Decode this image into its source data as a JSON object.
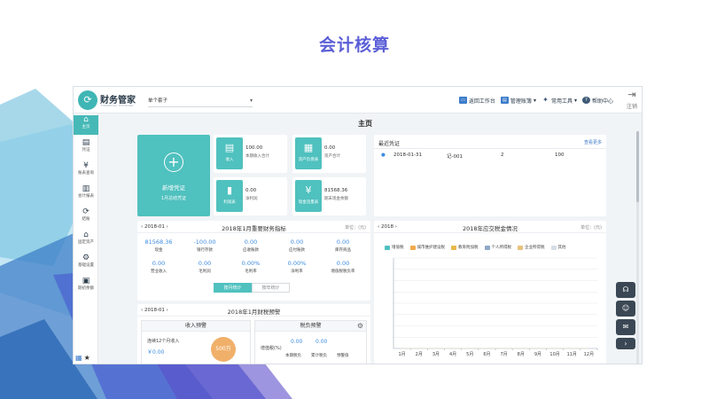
{
  "slide": {
    "title": "会计核算"
  },
  "brand": {
    "name": "财务管家",
    "tagline": "FINANCIAL STEWARD"
  },
  "account": {
    "selected": "单个套子"
  },
  "top_actions": [
    {
      "label": "返回工作台",
      "icon": "monitor-icon"
    },
    {
      "label": "管理账簿",
      "icon": "ledger-icon"
    },
    {
      "label": "常用工具",
      "icon": "wrench-icon"
    },
    {
      "label": "帮助中心",
      "icon": "help-icon"
    }
  ],
  "logout": {
    "label": "注销"
  },
  "sidenav": [
    {
      "label": "主页",
      "glyph": "⌂",
      "active": true
    },
    {
      "label": "凭证",
      "glyph": "▤"
    },
    {
      "label": "账表查询",
      "glyph": "¥"
    },
    {
      "label": "会计报表",
      "glyph": "▥"
    },
    {
      "label": "结账",
      "glyph": "⟳"
    },
    {
      "label": "固定资产",
      "glyph": "⌂"
    },
    {
      "label": "基础设置",
      "glyph": "⚙"
    },
    {
      "label": "期初余额",
      "glyph": "▣"
    }
  ],
  "main": {
    "title": "主页"
  },
  "new_voucher": {
    "label": "新增凭证",
    "sub": "1月总结凭证"
  },
  "tiles": [
    {
      "name": "income",
      "tile": "收入",
      "icon": "clipboard-icon",
      "glyph": "▤",
      "value": "100.00",
      "desc": "本期收入合计"
    },
    {
      "name": "assets",
      "tile": "资产负债表",
      "icon": "balance-sheet-icon",
      "glyph": "▦",
      "value": "0.00",
      "desc": "资产合计"
    },
    {
      "name": "profit",
      "tile": "利润表",
      "icon": "bar-chart-icon",
      "glyph": "▮",
      "value": "0.00",
      "desc": "净利润"
    },
    {
      "name": "cashflow",
      "tile": "现金流量表",
      "icon": "cash-icon",
      "glyph": "¥",
      "value": "81568.36",
      "desc": "期末现金余额"
    }
  ],
  "recent": {
    "title": "最近凭证",
    "more": "查看更多",
    "rows": [
      {
        "date": "2018-01-31",
        "voucher": "记-001",
        "count": "2",
        "amount": "100"
      }
    ]
  },
  "indicators": {
    "date": "2018-01",
    "title": "2018年1月重要财务指标",
    "unit": "单位：(元)",
    "row1": [
      {
        "value": "81568.36",
        "label": "现金"
      },
      {
        "value": "-100.00",
        "label": "银行存款"
      },
      {
        "value": "0.00",
        "label": "应收账款"
      },
      {
        "value": "0.00",
        "label": "应付账款"
      },
      {
        "value": "0.00",
        "label": "库存商品"
      }
    ],
    "row2": [
      {
        "value": "0.00",
        "label": "营业收入"
      },
      {
        "value": "0.00",
        "label": "毛利润"
      },
      {
        "value": "0.00%",
        "label": "毛利率"
      },
      {
        "value": "0.00%",
        "label": "净利率"
      },
      {
        "value": "0.00",
        "label": "增值税税负率"
      }
    ],
    "toggle": {
      "on": "按月统计",
      "off": "按年统计"
    }
  },
  "tax_chart": {
    "year": "2018",
    "title": "2018年应交税金情况",
    "unit": "单位：(元)"
  },
  "chart_data": {
    "type": "line",
    "title": "2018年应交税金情况",
    "categories": [
      "1月",
      "2月",
      "3月",
      "4月",
      "5月",
      "6月",
      "7月",
      "8月",
      "9月",
      "10月",
      "11月",
      "12月"
    ],
    "series": [
      {
        "name": "增值税",
        "color": "#4fc1bf",
        "values": [
          0,
          0,
          0,
          0,
          0,
          0,
          0,
          0,
          0,
          0,
          0,
          0
        ]
      },
      {
        "name": "城市维护建设税",
        "color": "#f0a94a",
        "values": [
          0,
          0,
          0,
          0,
          0,
          0,
          0,
          0,
          0,
          0,
          0,
          0
        ]
      },
      {
        "name": "教育附加税",
        "color": "#e8b84a",
        "values": [
          0,
          0,
          0,
          0,
          0,
          0,
          0,
          0,
          0,
          0,
          0,
          0
        ]
      },
      {
        "name": "个人所得税",
        "color": "#8fa8c8",
        "values": [
          0,
          0,
          0,
          0,
          0,
          0,
          0,
          0,
          0,
          0,
          0,
          0
        ]
      },
      {
        "name": "企业所得税",
        "color": "#e6c27a",
        "values": [
          0,
          0,
          0,
          0,
          0,
          0,
          0,
          0,
          0,
          0,
          0,
          0
        ]
      },
      {
        "name": "其他",
        "color": "#d5dde6",
        "values": [
          0,
          0,
          0,
          0,
          0,
          0,
          0,
          0,
          0,
          0,
          0,
          0
        ]
      }
    ],
    "grid": true
  },
  "warnings": {
    "date": "2018-01",
    "title": "2018年1月财税预警",
    "income": {
      "title": "收入预警",
      "desc": "连续12个月收入",
      "value": "￥0.00",
      "badge": "500万"
    },
    "tax": {
      "title": "税负预警",
      "vat": "增值税(%)",
      "v1": "0.00",
      "v2": "0.00",
      "l1": "本期税负",
      "l2": "累计税负",
      "l3": "预警值"
    }
  },
  "floatbar": [
    "headset-icon",
    "user-group-icon",
    "chat-icon",
    "chevron-right-icon"
  ]
}
